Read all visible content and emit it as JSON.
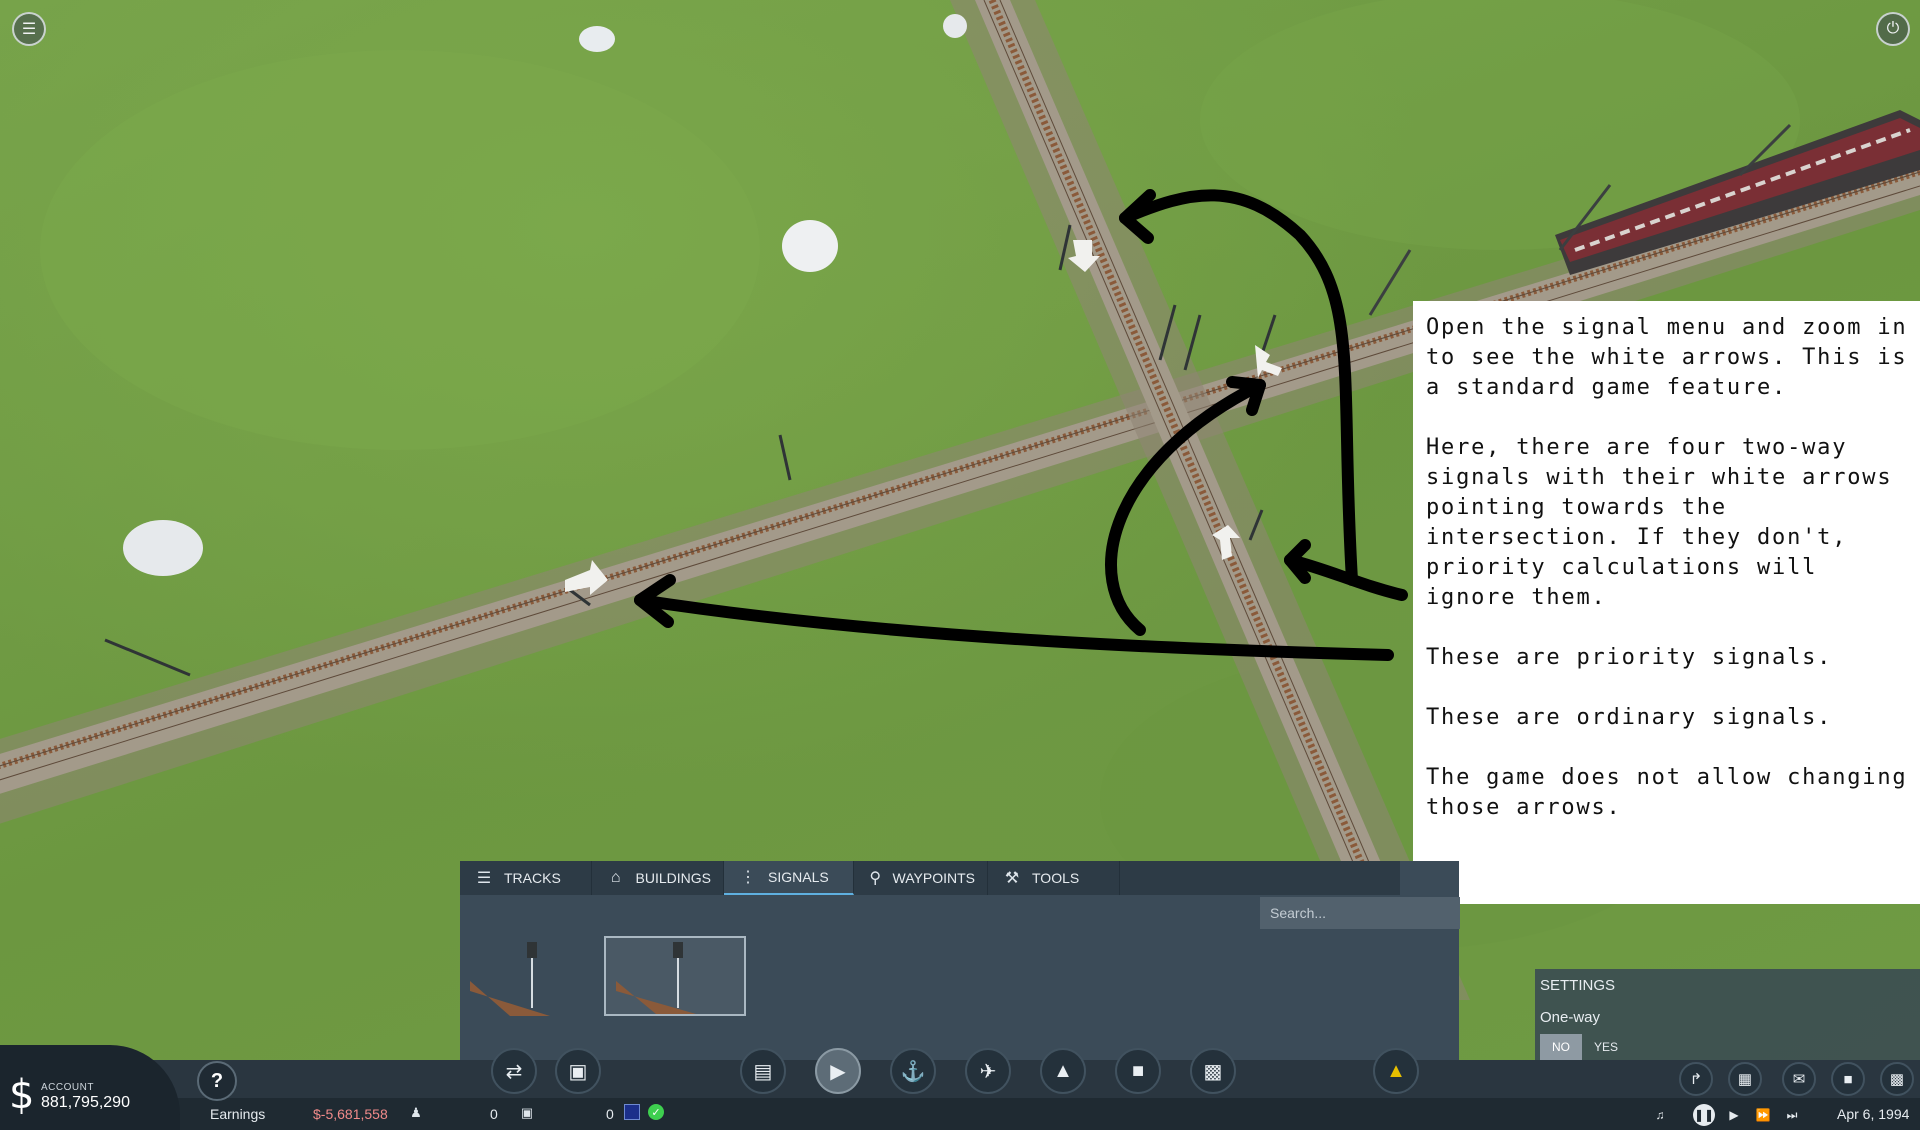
{
  "overlay": {
    "paragraphs": [
      "Open the signal menu and zoom in to see the white arrows. This is a standard game feature.",
      "Here, there are four two-way signals with their white arrows pointing towards the intersection. If they don't, priority calculations will ignore them.",
      "These are priority signals.",
      "These are ordinary signals.",
      "The game does not allow changing those arrows."
    ]
  },
  "build_menu": {
    "tabs": [
      {
        "label": "TRACKS",
        "icon": "tracks-icon",
        "active": false
      },
      {
        "label": "BUILDINGS",
        "icon": "buildings-icon",
        "active": false
      },
      {
        "label": "SIGNALS",
        "icon": "signal-icon",
        "active": true
      },
      {
        "label": "WAYPOINTS",
        "icon": "waypoint-pin-icon",
        "active": false
      },
      {
        "label": "TOOLS",
        "icon": "tools-icon",
        "active": false
      }
    ],
    "search_placeholder": "Search...",
    "items": [
      {
        "name": "two-way-signal",
        "selected": false
      },
      {
        "name": "one-way-signal",
        "selected": true
      }
    ]
  },
  "settings": {
    "title": "SETTINGS",
    "option_label": "One-way",
    "no_label": "NO",
    "yes_label": "YES",
    "selected": "NO"
  },
  "account": {
    "label": "ACCOUNT",
    "value": "881,795,290",
    "currency_symbol": "$"
  },
  "status_bar": {
    "earnings_label": "Earnings",
    "earnings_value": "$-5,681,558",
    "passengers_count": "0",
    "cargo_count": "0",
    "date": "Apr 6, 1994"
  },
  "toolbar": {
    "help": "?",
    "tools": [
      "line-manager-icon",
      "vehicle-manager-icon",
      "road-vehicle-icon",
      "train-icon",
      "ship-icon",
      "plane-icon",
      "terrain-icon",
      "town-icon",
      "industry-icon",
      "bulldoze-icon"
    ],
    "active_tool": "train-icon",
    "right_tools": [
      "track-tool-icon",
      "station-tool-icon",
      "message-icon",
      "city-icon",
      "factory-icon"
    ]
  },
  "colors": {
    "panel_bg": "#3b4b58",
    "bar_bg": "#2a3640",
    "earnings_negative": "#f08a8a",
    "grass": "#6f9a42",
    "annotation_arrows": "#000000"
  }
}
